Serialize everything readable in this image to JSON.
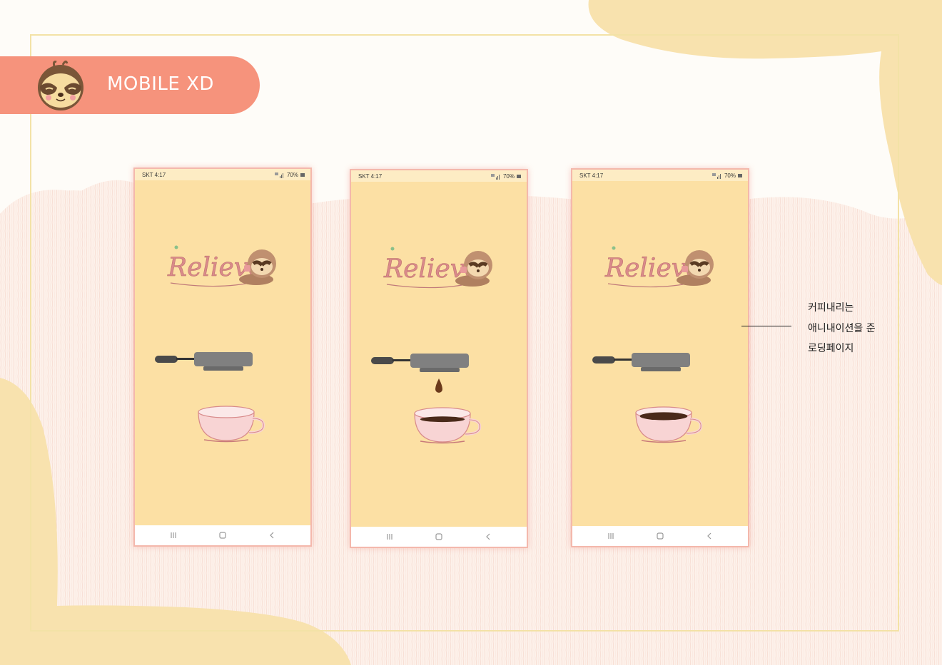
{
  "banner": {
    "title": "MOBILE XD"
  },
  "phones": [
    {
      "status": {
        "carrier": "SKT 4:17",
        "battery": "70%"
      },
      "logo_text": "Relieve",
      "coffee_fill": 0,
      "drip": false
    },
    {
      "status": {
        "carrier": "SKT 4:17",
        "battery": "70%"
      },
      "logo_text": "Relieve",
      "coffee_fill": 0.3,
      "drip": true
    },
    {
      "status": {
        "carrier": "SKT 4:17",
        "battery": "70%"
      },
      "logo_text": "Relieve",
      "coffee_fill": 0.85,
      "drip": false
    }
  ],
  "nav_icons": [
    "recent-apps-icon",
    "home-icon",
    "back-icon"
  ],
  "caption": {
    "line1": "커피내리는",
    "line2": "애니내이션을 준",
    "line3": "로딩페이지"
  },
  "colors": {
    "banner": "#f6937c",
    "phone_bg": "#fce0a4",
    "blob": "#f8e2ae",
    "cup": "#f8d4d4",
    "coffee": "#4a2a1a"
  }
}
